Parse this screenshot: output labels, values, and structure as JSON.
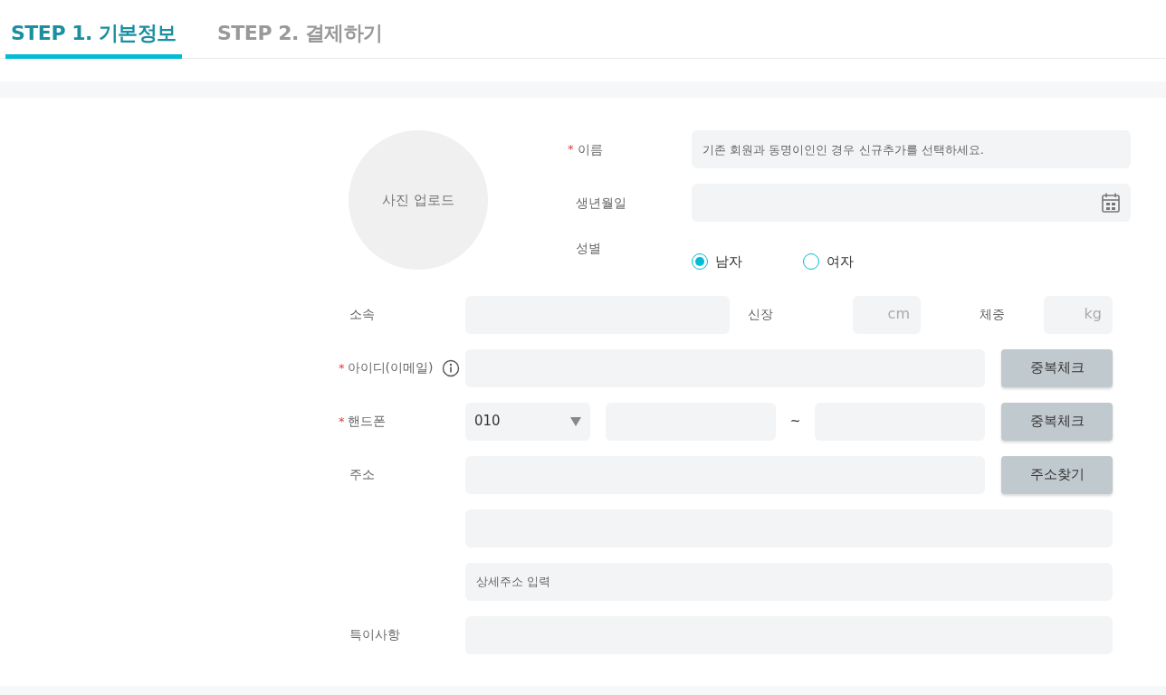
{
  "tabs": [
    {
      "label": "STEP 1. 기본정보",
      "selected": true
    },
    {
      "label": "STEP 2. 결제하기",
      "selected": false
    }
  ],
  "required_mark": "*",
  "photo": {
    "label": "사진 업로드"
  },
  "name": {
    "label": "이름",
    "required": true,
    "placeholder": "기존 회원과 동명이인인 경우 신규추가를 선택하세요."
  },
  "birthdate": {
    "label": "생년월일",
    "required": false
  },
  "gender": {
    "label": "성별",
    "required": false,
    "options": [
      {
        "label": "남자",
        "selected": true
      },
      {
        "label": "여자",
        "selected": false
      }
    ]
  },
  "affiliation": {
    "label": "소속",
    "required": false
  },
  "height": {
    "label": "신장",
    "placeholder": "cm"
  },
  "weight": {
    "label": "체중",
    "placeholder": "kg"
  },
  "user_id": {
    "label": "아이디(이메일)",
    "required": true,
    "button": "중복체크"
  },
  "phone": {
    "label": "핸드폰",
    "required": true,
    "prefix": "010",
    "separator": "~",
    "button": "중복체크"
  },
  "address": {
    "label": "주소",
    "required": false,
    "button": "주소찾기",
    "detail_placeholder": "상세주소 입력"
  },
  "notes": {
    "label": "특이사항",
    "required": false
  }
}
